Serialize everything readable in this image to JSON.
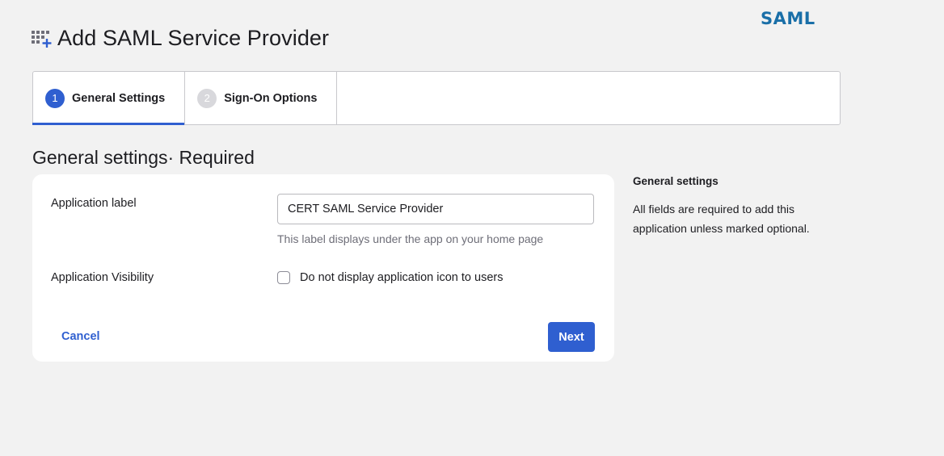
{
  "logo": {
    "text": "SAML"
  },
  "header": {
    "title": "Add SAML Service Provider",
    "icon": "apps-add-icon"
  },
  "steps": [
    {
      "number": "1",
      "label": "General Settings",
      "active": true
    },
    {
      "number": "2",
      "label": "Sign-On Options",
      "active": false
    }
  ],
  "section": {
    "title": "General settings· Required"
  },
  "form": {
    "app_label": {
      "label": "Application label",
      "value": "CERT SAML Service Provider",
      "helper": "This label displays under the app on your home page"
    },
    "visibility": {
      "label": "Application Visibility",
      "checkbox_label": "Do not display application icon to users",
      "checked": false
    },
    "cancel_label": "Cancel",
    "next_label": "Next"
  },
  "side_help": {
    "title": "General settings",
    "text": "All fields are required to add this application unless marked optional."
  },
  "colors": {
    "accent": "#2f5fd0",
    "logo": "#1a6fa8",
    "background": "#f2f2f2"
  }
}
